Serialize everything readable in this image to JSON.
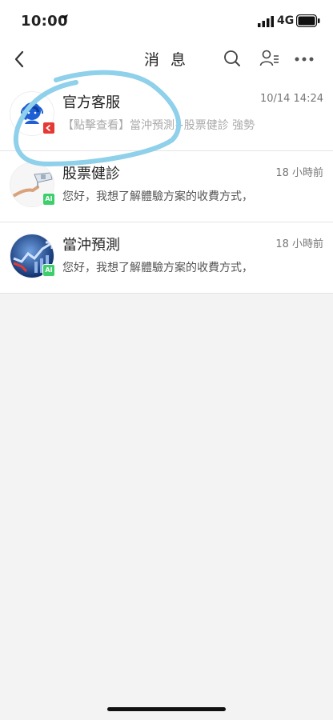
{
  "status_bar": {
    "time": "10:00",
    "network": "4G",
    "icons": [
      "location-arrow-icon",
      "signal-icon",
      "battery-icon"
    ]
  },
  "header": {
    "title": "消 息",
    "icons": [
      "back-icon",
      "search-icon",
      "contacts-icon",
      "more-icon"
    ]
  },
  "conversations": [
    {
      "name": "官方客服",
      "time": "10/14 14:24",
      "preview": "【點擊查看】當沖預測+股票健診 強勢",
      "avatar_icon": "headset-agent-icon",
      "badge_color": "#e53935"
    },
    {
      "name": "股票健診",
      "time": "18 小時前",
      "preview": "您好，我想了解體驗方案的收費方式，",
      "avatar_icon": "robot-hand-icon",
      "badge_text": "AI",
      "badge_color": "#3ccf6b"
    },
    {
      "name": "當沖預測",
      "time": "18 小時前",
      "preview": "您好，我想了解體驗方案的收費方式，",
      "avatar_icon": "stock-chart-globe-icon",
      "badge_text": "AI",
      "badge_color": "#3ccf6b"
    }
  ],
  "colors": {
    "annotation_stroke": "#8fd0ea",
    "brand_blue": "#1e5fd6"
  }
}
